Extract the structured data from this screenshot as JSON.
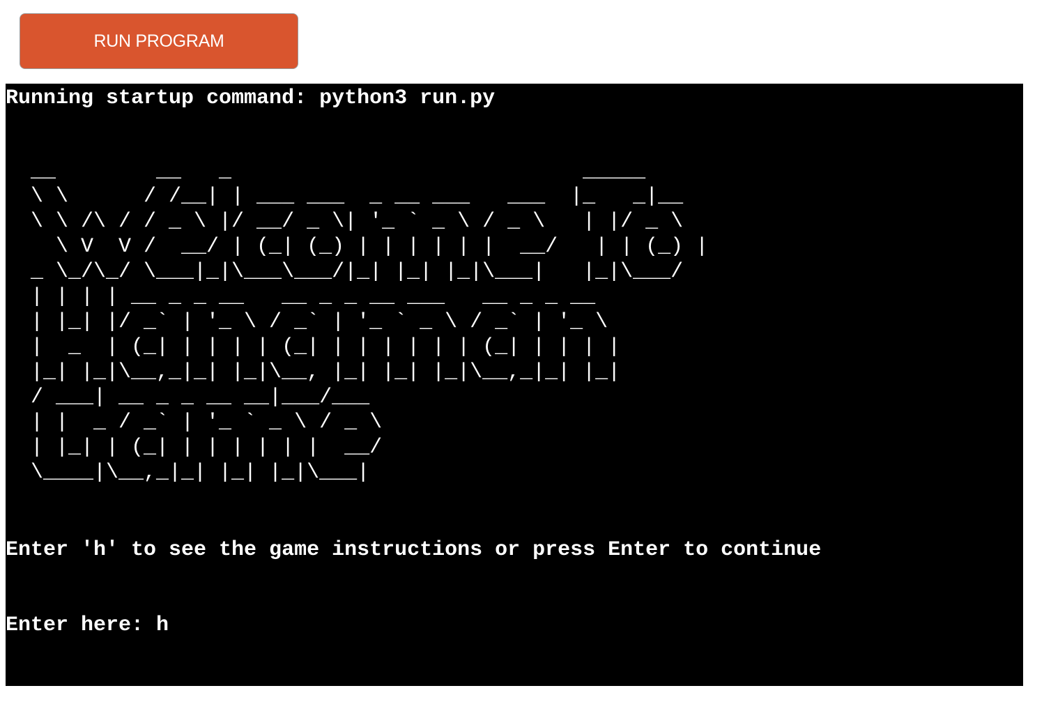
{
  "toolbar": {
    "run_label": "RUN PROGRAM"
  },
  "terminal": {
    "startup_line": "Running startup command: python3 run.py",
    "banner_art": "  __        __   _                            _____\n  \\ \\      / /__| | ___ ___  _ __ ___   ___  |_   _|__\n  \\ \\ /\\ / / _ \\ |/ __/ _ \\| '_ ` _ \\ / _ \\   | |/ _ \\\n    \\ V  V /  __/ | (_| (_) | | | | | |  __/   | | (_) |\n  _ \\_/\\_/ \\___|_|\\___\\___/|_| |_| |_|\\___|   |_|\\___/\n  | | | | __ _ _ __   __ _ _ __ ___   __ _ _ __\n  | |_| |/ _` | '_ \\ / _` | '_ ` _ \\ / _` | '_ \\\n  |  _  | (_| | | | | (_| | | | | | | (_| | | | |\n  |_| |_|\\__,_|_| |_|\\__, |_| |_| |_|\\__,_|_| |_|\n  / ___| __ _ _ __ __|___/___\n  | |  _ / _` | '_ ` _ \\ / _ \\\n  | |_| | (_| | | | | | |  __/\n  \\____|\\__,_|_| |_| |_|\\___|",
    "prompt_line": "Enter 'h' to see the game instructions or press Enter to continue",
    "input_prefix": "Enter here: ",
    "input_value": "h"
  },
  "colors": {
    "button_bg": "#d9552e",
    "terminal_bg": "#000000",
    "terminal_fg": "#ffffff"
  }
}
